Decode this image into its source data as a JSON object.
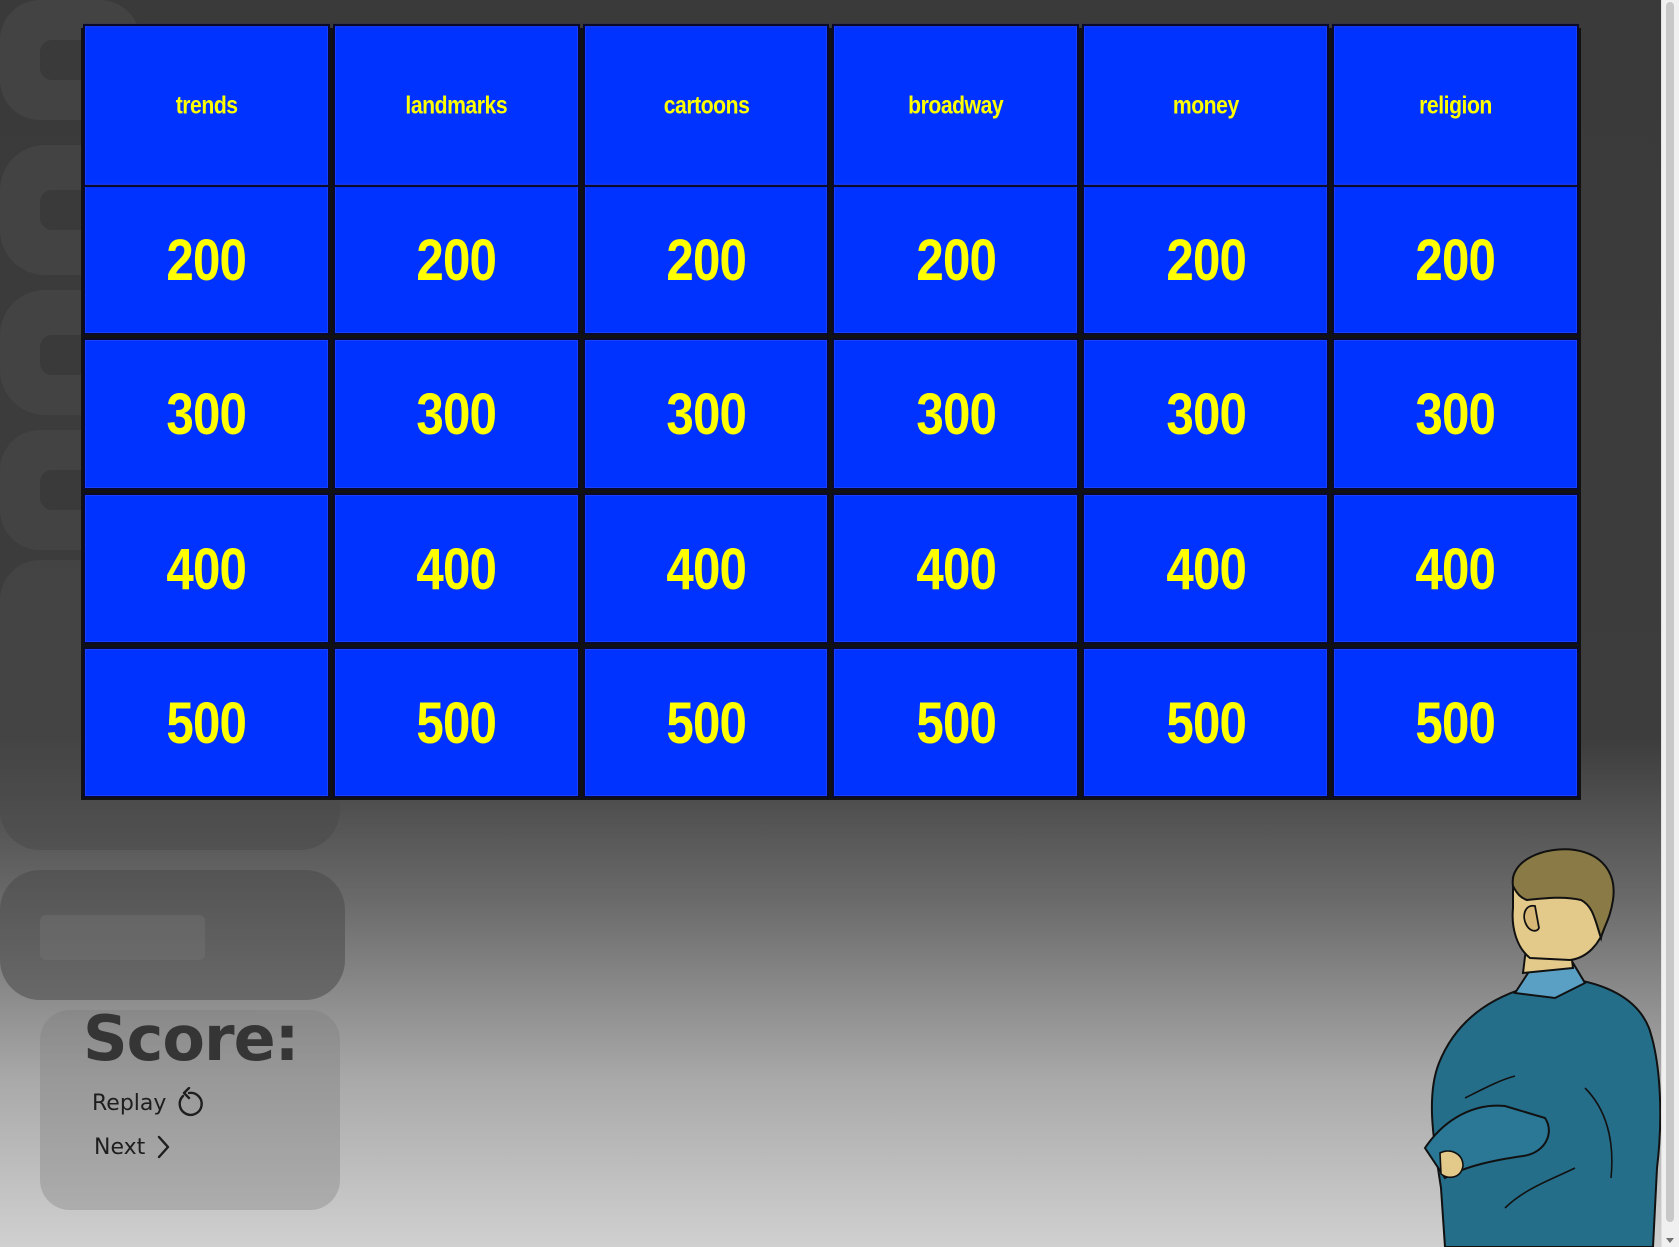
{
  "board": {
    "categories": [
      "trends",
      "landmarks",
      "cartoons",
      "broadway",
      "money",
      "religion"
    ],
    "rows": [
      [
        "200",
        "200",
        "200",
        "200",
        "200",
        "200"
      ],
      [
        "300",
        "300",
        "300",
        "300",
        "300",
        "300"
      ],
      [
        "400",
        "400",
        "400",
        "400",
        "400",
        "400"
      ],
      [
        "500",
        "500",
        "500",
        "500",
        "500",
        "500"
      ]
    ]
  },
  "score": {
    "label": "Score:",
    "value": ""
  },
  "controls": {
    "replay_label": "Replay",
    "next_label": "Next"
  },
  "icons": {
    "replay": "replay-icon",
    "next": "chevron-right-icon"
  },
  "colors": {
    "tile": "#0033ff",
    "tile_text": "#ffff00",
    "score_text": "#353535"
  }
}
